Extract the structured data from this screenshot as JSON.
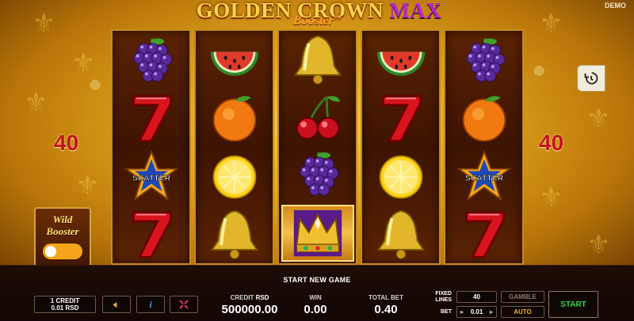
{
  "header": {
    "logo_main": "GOLDEN CROWN",
    "logo_max": "MAX",
    "logo_sub": "Booster",
    "logo_tm": "TM",
    "demo_label": "DEMO"
  },
  "paylines": {
    "left": "40",
    "right": "40"
  },
  "reels": [
    [
      "grape",
      "seven",
      "scatter",
      "seven"
    ],
    [
      "watermelon",
      "orange",
      "lemon",
      "bell"
    ],
    [
      "bell",
      "cherry",
      "grape",
      "crown"
    ],
    [
      "watermelon",
      "seven",
      "lemon",
      "bell"
    ],
    [
      "grape",
      "orange",
      "scatter",
      "seven"
    ]
  ],
  "scatter_label": "SCATTER",
  "wild_booster": {
    "line1": "Wild",
    "line2": "Booster",
    "enabled": false
  },
  "history_icon": "history-icon",
  "bottom": {
    "start_new_game": "START NEW GAME",
    "credit_info_line1": "1 CREDIT",
    "credit_info_line2": "0.01 RSD",
    "credit_label": "CREDIT",
    "credit_unit": "RSD",
    "credit_value": "500000.00",
    "win_label": "WIN",
    "win_value": "0.00",
    "total_bet_label": "TOTAL BET",
    "total_bet_value": "0.40",
    "fixed_lines_label_1": "FIXED",
    "fixed_lines_label_2": "LINES",
    "fixed_lines_value": "40",
    "bet_label": "BET",
    "bet_value": "0.01",
    "gamble_label": "GAMBLE",
    "auto_label": "AUTO",
    "start_label": "START"
  },
  "colors": {
    "accent_gold": "#f5b32a",
    "start_green": "#34d14a",
    "lines_red": "#c2131a",
    "reel_bg": "#3d1402"
  }
}
